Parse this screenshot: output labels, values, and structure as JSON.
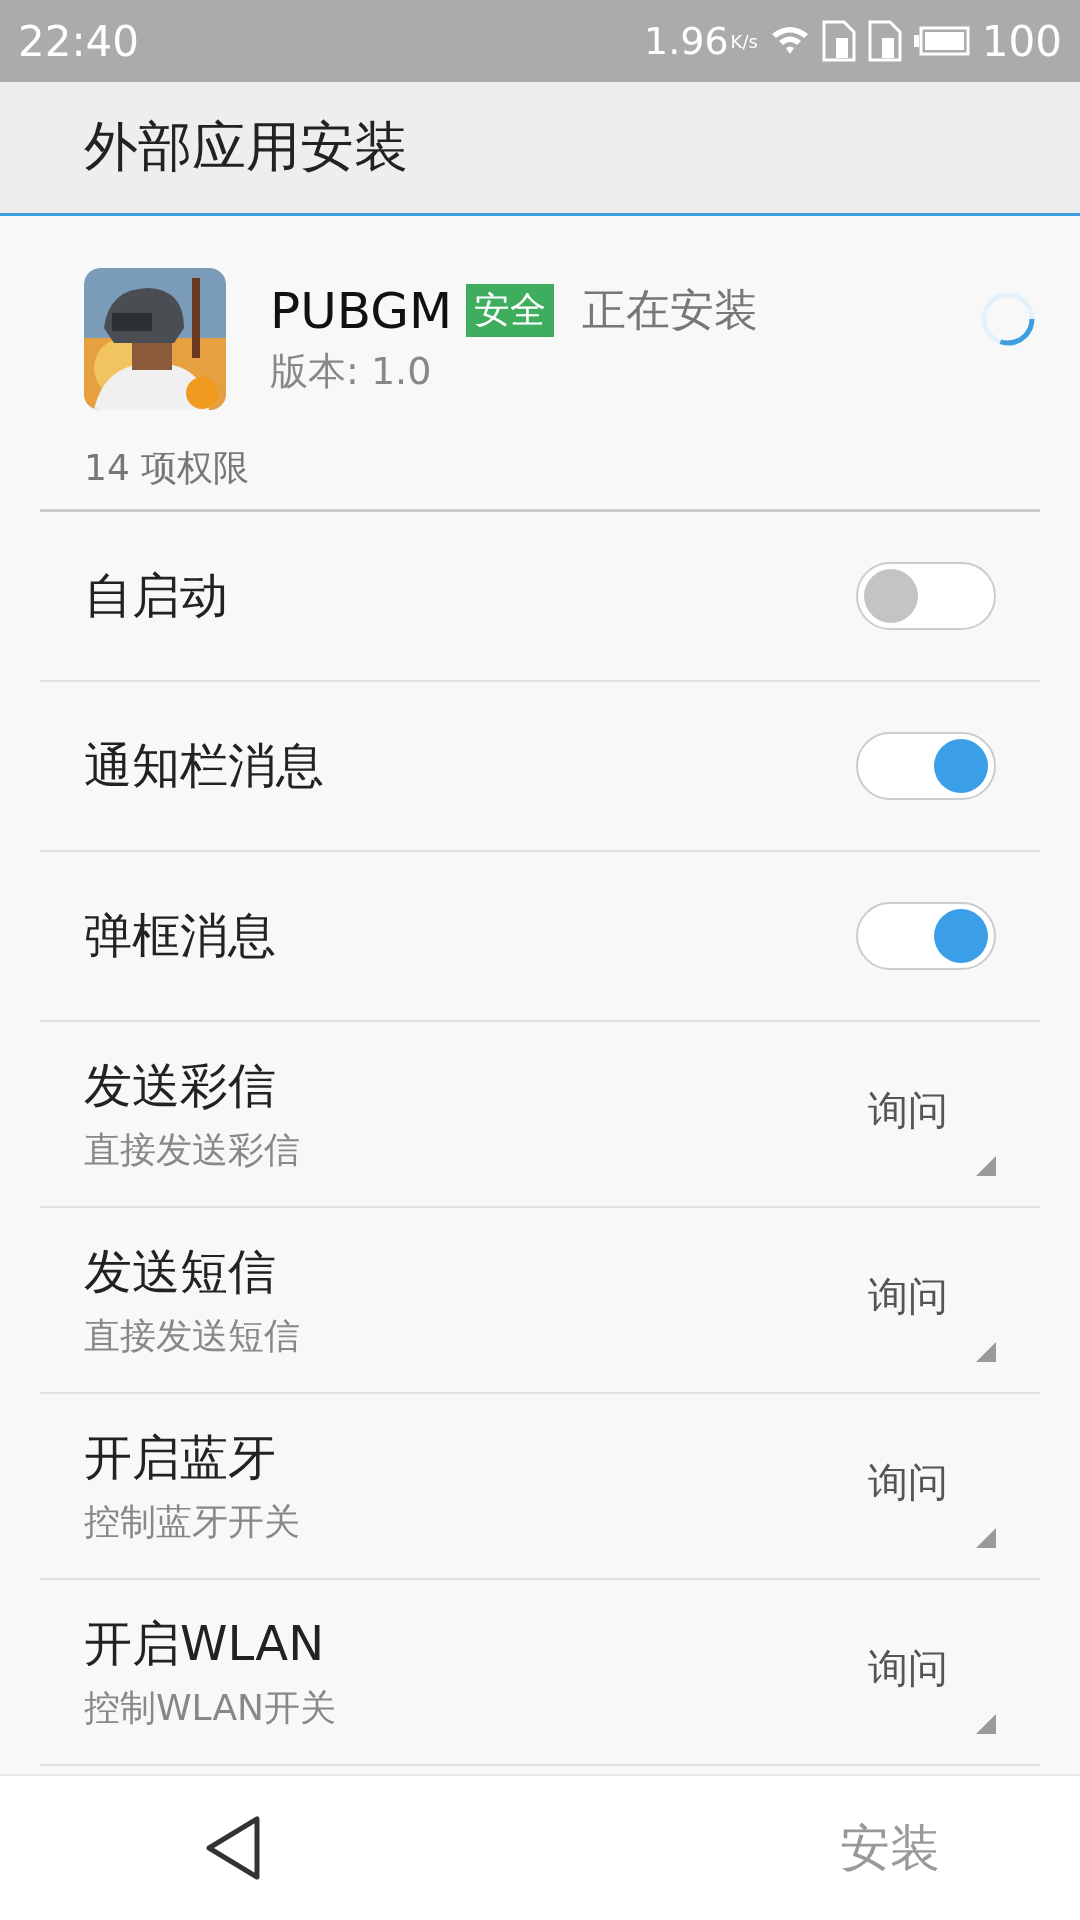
{
  "status_bar": {
    "time": "22:40",
    "speed": "1.96",
    "speed_unit": "K/s",
    "battery": "100"
  },
  "title": "外部应用安装",
  "app": {
    "kind": "picture",
    "name": "PUBGM",
    "badge": "安全",
    "status": "正在安装",
    "version": "版本: 1.0",
    "progress": {
      "level": 0.3
    }
  },
  "permissions_count": "14 项权限",
  "permissions": [
    {
      "kind": "toggle",
      "label": "自启动",
      "on": false
    },
    {
      "kind": "toggle",
      "label": "通知栏消息",
      "on": true
    },
    {
      "kind": "toggle",
      "label": "弹框消息",
      "on": true
    },
    {
      "kind": "choice",
      "label": "发送彩信",
      "description": "直接发送彩信",
      "value": "询问"
    },
    {
      "kind": "choice",
      "label": "发送短信",
      "description": "直接发送短信",
      "value": "询问"
    },
    {
      "kind": "choice",
      "label": "开启蓝牙",
      "description": "控制蓝牙开关",
      "value": "询问"
    },
    {
      "kind": "choice",
      "label": "开启WLAN",
      "description": "控制WLAN开关",
      "value": "询问"
    }
  ],
  "bottom_bar": {
    "install_button": "安装"
  }
}
